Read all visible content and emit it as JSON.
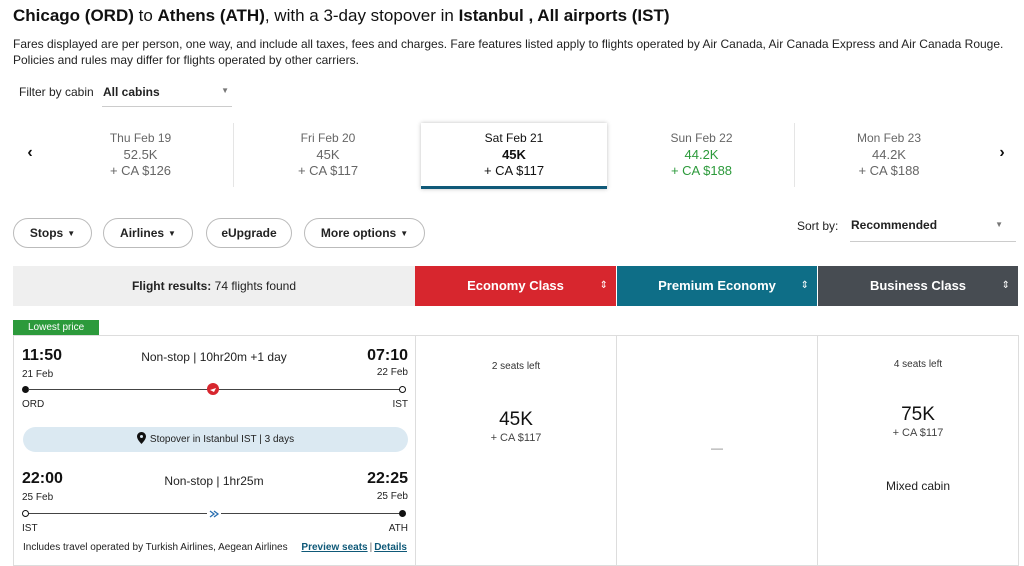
{
  "header": {
    "origin": "Chicago (ORD)",
    "to": " to ",
    "destination": "Athens (ATH)",
    "stopover_text": ", with a 3-day stopover in ",
    "stopover_city": "Istanbul , All airports (IST)"
  },
  "subtitle": "Fares displayed are per person, one way, and include all taxes, fees and charges. Fare features listed apply to flights operated by Air Canada, Air Canada Express and Air Canada Rouge. Policies and rules may differ for flights operated by other carriers.",
  "filter": {
    "label": "Filter by cabin",
    "value": "All cabins"
  },
  "dates": [
    {
      "day": "Thu Feb 19",
      "points": "52.5K",
      "cash": "+ CA $126"
    },
    {
      "day": "Fri Feb 20",
      "points": "45K",
      "cash": "+ CA $117"
    },
    {
      "day": "Sat Feb 21",
      "points": "45K",
      "cash": "+ CA $117"
    },
    {
      "day": "Sun Feb 22",
      "points": "44.2K",
      "cash": "+ CA $188"
    },
    {
      "day": "Mon Feb 23",
      "points": "44.2K",
      "cash": "+ CA $188"
    }
  ],
  "filters": {
    "stops": "Stops",
    "airlines": "Airlines",
    "eupgrade": "eUpgrade",
    "more": "More options"
  },
  "sort": {
    "label": "Sort by:",
    "value": "Recommended"
  },
  "results": {
    "label": "Flight results:",
    "count": "74 flights found"
  },
  "cabins": {
    "economy": "Economy Class",
    "premium": "Premium Economy",
    "business": "Business Class"
  },
  "colors": {
    "economy": "#d7262e",
    "premium": "#0e6e87",
    "business": "#474c52",
    "accent": "#0f5978",
    "green": "#2c9a3b"
  },
  "flight": {
    "badge": "Lowest price",
    "seg1": {
      "dep_time": "11:50",
      "dep_date": "21 Feb",
      "info": "Non-stop | 10hr20m +1 day",
      "arr_time": "07:10",
      "arr_date": "22 Feb",
      "from": "ORD",
      "to": "IST"
    },
    "stopover": "Stopover in Istanbul IST | 3 days",
    "seg2": {
      "dep_time": "22:00",
      "dep_date": "25 Feb",
      "info": "Non-stop | 1hr25m",
      "arr_time": "22:25",
      "arr_date": "25 Feb",
      "from": "IST",
      "to": "ATH"
    },
    "operated": "Includes travel operated by Turkish Airlines, Aegean Airlines",
    "preview": "Preview seats",
    "details": "Details"
  },
  "fares": {
    "economy": {
      "seats": "2 seats left",
      "points": "45K",
      "cash": "+ CA $117"
    },
    "premium": {
      "value": "—"
    },
    "business": {
      "seats": "4 seats left",
      "points": "75K",
      "cash": "+ CA $117",
      "note": "Mixed cabin"
    }
  }
}
